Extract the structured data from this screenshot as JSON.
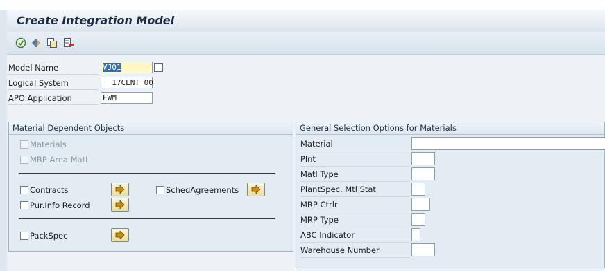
{
  "screen": {
    "title": "Create Integration Model"
  },
  "toolbar": {
    "icons": [
      "execute-icon",
      "variant-icon",
      "copy-icon",
      "delete-icon"
    ]
  },
  "header_fields": {
    "model_name": {
      "label": "Model Name",
      "value": "VJ01"
    },
    "logical_system": {
      "label": "Logical System",
      "value": "  17CLNT 00"
    },
    "apo_application": {
      "label": "APO Application",
      "value": "EWM"
    }
  },
  "material_dependent": {
    "title": "Material Dependent Objects",
    "materials": "Materials",
    "mrp_area_matl": "MRP Area Matl",
    "contracts": "Contracts",
    "sched_agreements": "SchedAgreements",
    "pur_info_record": "Pur.Info Record",
    "pack_spec": "PackSpec"
  },
  "general_selection": {
    "title": "General Selection Options for Materials",
    "fields": [
      {
        "label": "Material",
        "value": ""
      },
      {
        "label": "Plnt",
        "value": ""
      },
      {
        "label": "Matl Type",
        "value": ""
      },
      {
        "label": "PlantSpec. Mtl Stat",
        "value": ""
      },
      {
        "label": "MRP Ctrlr",
        "value": ""
      },
      {
        "label": "MRP Type",
        "value": ""
      },
      {
        "label": "ABC Indicator",
        "value": ""
      },
      {
        "label": "Warehouse Number",
        "value": ""
      }
    ]
  },
  "colors": {
    "background": "#dfe6ee",
    "title_text": "#1b2d45",
    "selected_field": "#fff7c4",
    "push_button": "#eadf9a"
  }
}
